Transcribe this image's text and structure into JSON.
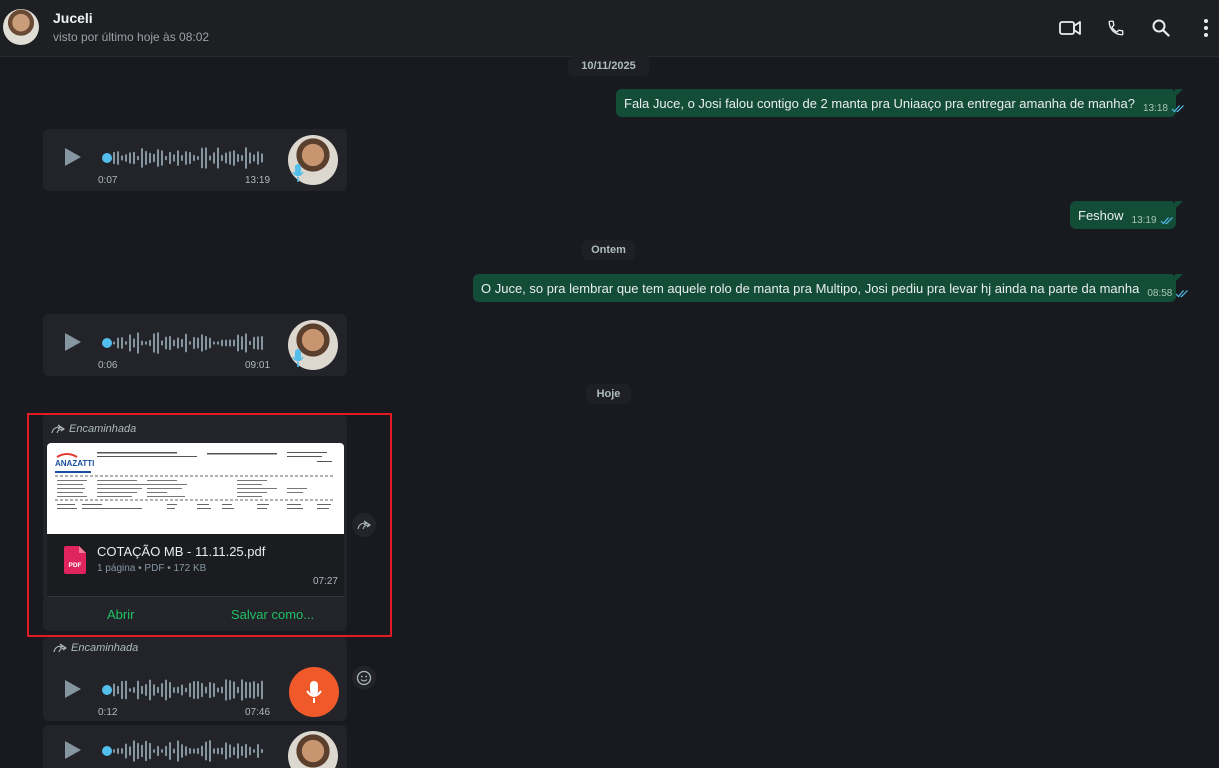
{
  "header": {
    "contact_name": "Juceli",
    "status": "visto por último hoje às 08:02",
    "icons": [
      "video-call-icon",
      "voice-call-icon",
      "search-icon",
      "more-options-icon"
    ]
  },
  "dates": {
    "d1": "10/11/2025",
    "d2": "Ontem",
    "d3": "Hoje"
  },
  "messages": {
    "m1": {
      "text": "Fala Juce, o Josi falou contigo de 2 manta pra Uniaaço pra entregar amanha de manha?",
      "time": "13:18"
    },
    "m2": {
      "text": "Feshow",
      "time": "13:19"
    },
    "m3": {
      "text": "O Juce, so pra lembrar que tem aquele rolo de manta pra Multipo, Josi pediu pra levar hj ainda na parte da manha",
      "time": "08:58"
    }
  },
  "audios": {
    "a1": {
      "duration": "0:07",
      "time": "13:19"
    },
    "a2": {
      "duration": "0:06",
      "time": "09:01"
    },
    "a3": {
      "duration": "0:12",
      "time": "07:46",
      "forwarded_label": "Encaminhada"
    }
  },
  "document": {
    "forwarded_label": "Encaminhada",
    "file_name": "COTAÇÃO MB - 11.11.25.pdf",
    "file_meta": "1 página • PDF • 172 KB",
    "time": "07:27",
    "open_label": "Abrir",
    "save_label": "Salvar como...",
    "preview_logo": "ANAZATTI",
    "pdf_badge": "PDF"
  },
  "colors": {
    "outgoing_bubble": "#144d37",
    "incoming_bubble": "#222429",
    "accent_green": "#21c063",
    "highlight_border": "#e01b24",
    "mic_button": "#f05a2b",
    "audio_progress": "#53bdeb"
  }
}
